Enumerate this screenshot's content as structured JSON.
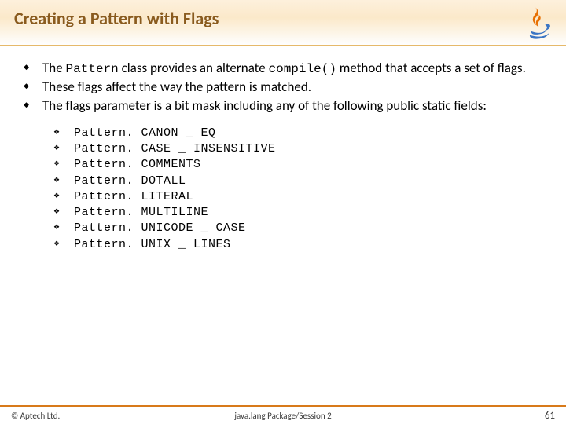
{
  "header": {
    "title": "Creating a Pattern with Flags"
  },
  "content": {
    "bullets": [
      {
        "pre": "The ",
        "code1": "Pattern",
        "mid": " class provides an alternate ",
        "code2": "compile()",
        "post": "  method that accepts a set of flags."
      },
      {
        "text": "These flags affect the way the pattern is matched."
      },
      {
        "text": "The flags parameter is a bit mask including any of the following public static fields:"
      }
    ],
    "flags": [
      "Pattern. CANON _ EQ",
      "Pattern. CASE _ INSENSITIVE",
      "Pattern. COMMENTS",
      "Pattern. DOTALL",
      "Pattern. LITERAL",
      "Pattern. MULTILINE",
      "Pattern. UNICODE _ CASE",
      "Pattern. UNIX _ LINES"
    ]
  },
  "footer": {
    "left": "© Aptech Ltd.",
    "center": "java.lang Package/Session 2",
    "right": "61"
  }
}
